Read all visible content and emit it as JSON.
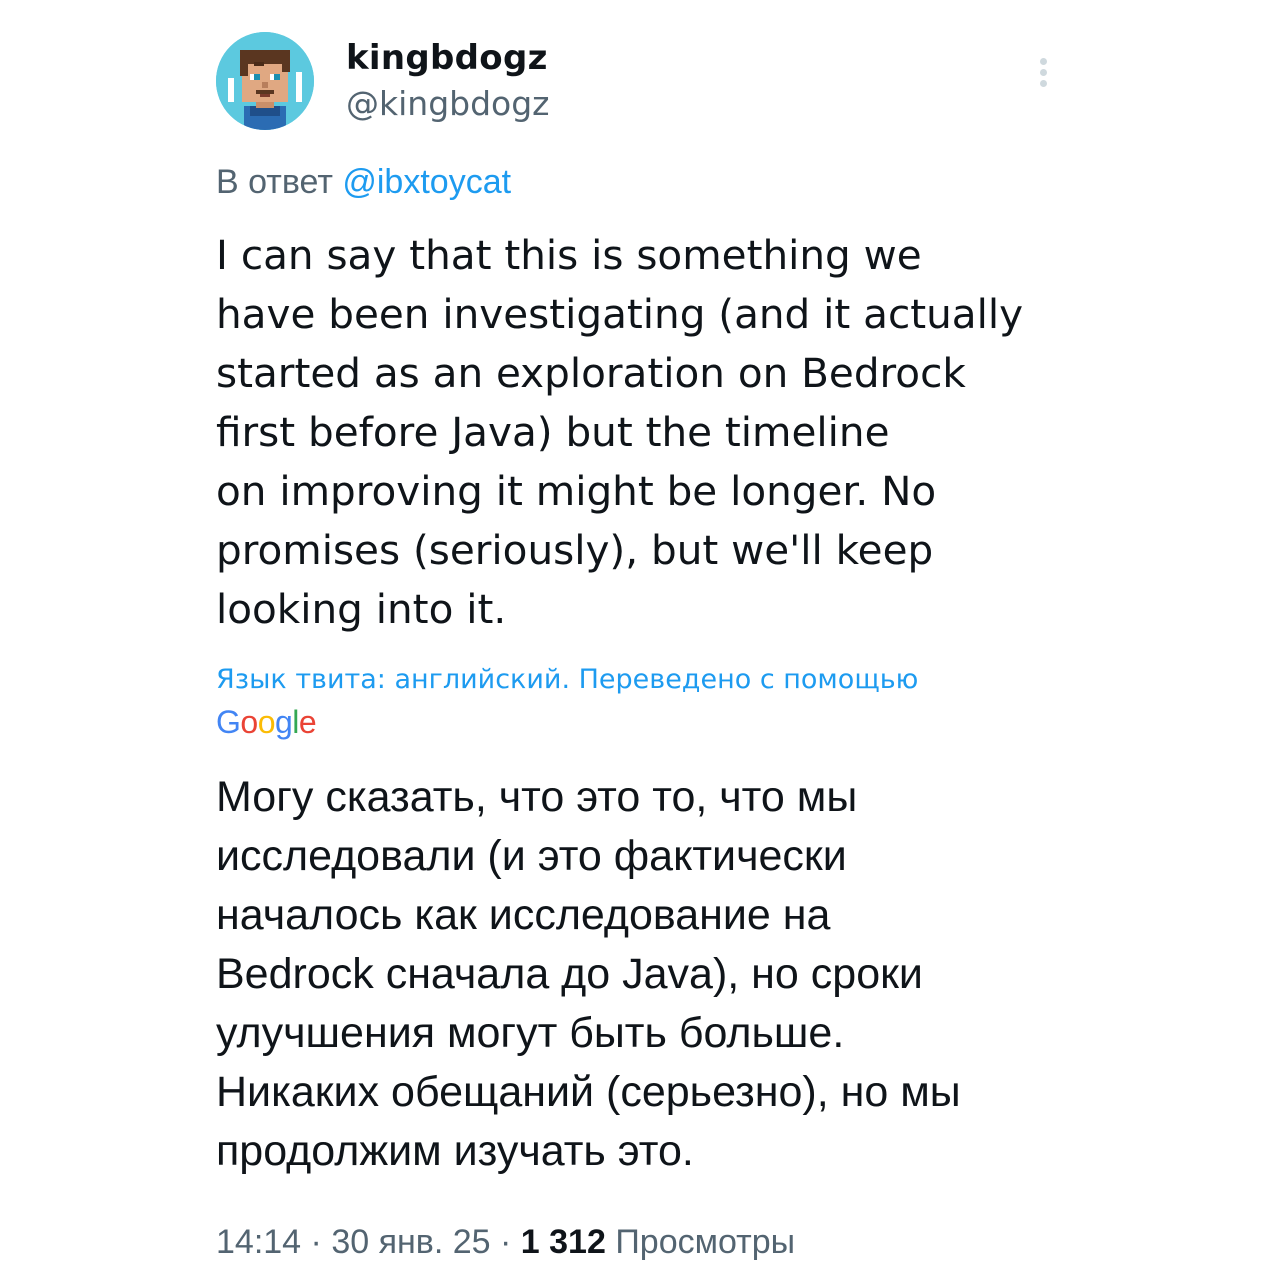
{
  "author": {
    "display_name": "kingbdogz",
    "handle": "@kingbdogz",
    "avatar_icon": "pixel-character-avatar"
  },
  "more_icon": "more-vertical-icon",
  "reply": {
    "prefix": "В ответ",
    "mention": "@ibxtoycat"
  },
  "tweet": {
    "text": "I can say that this is something we\nhave been investigating (and it actually\nstarted as an exploration on Bedrock\nfirst before Java) but the timeline\non improving it might be longer. No\npromises (seriously), but we'll keep\nlooking into it."
  },
  "translation": {
    "note": "Язык твита: английский. Переведено с помощью",
    "provider": "Google",
    "text": "Могу сказать, что это то, что мы\nисследовали (и это фактически\nначалось как исследование на\nBedrock сначала до Java), но сроки\nулучшения могут быть больше.\nНикаких обещаний (серьезно), но мы\nпродолжим изучать это."
  },
  "meta": {
    "time": "14:14",
    "separator": "·",
    "date": "30 янв. 25",
    "views_count": "1 312",
    "views_label": "Просмотры"
  },
  "colors": {
    "text_primary": "#0f1419",
    "text_secondary": "#536471",
    "link": "#1d9bf0",
    "avatar_bg": "#5cc9df"
  }
}
